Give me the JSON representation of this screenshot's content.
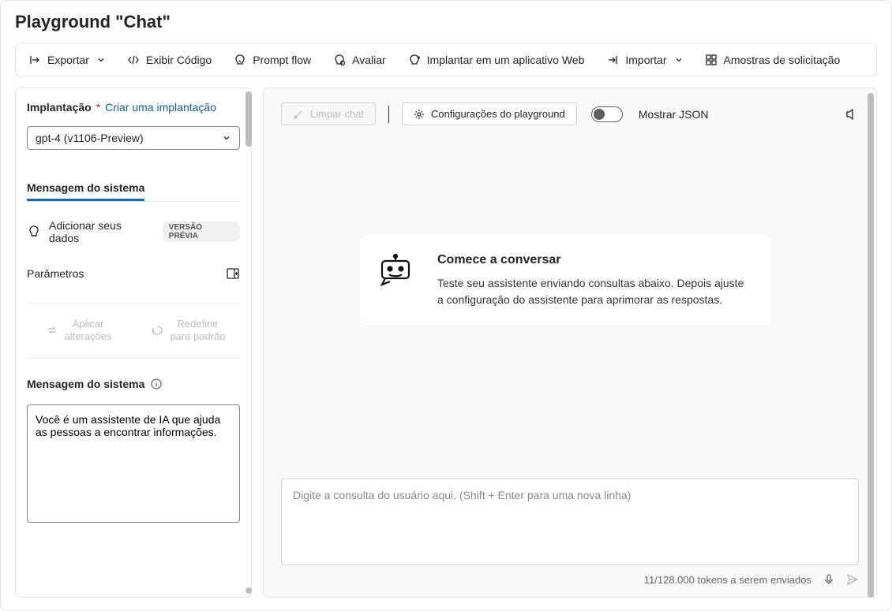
{
  "page_title": "Playground \"Chat\"",
  "toolbar": {
    "export": "Exportar",
    "view_code": "Exibir Código",
    "prompt_flow": "Prompt flow",
    "evaluate": "Avaliar",
    "deploy_web": "Implantar em um aplicativo Web",
    "import": "Importar",
    "samples": "Amostras de solicitação"
  },
  "sidebar": {
    "deployment_label": "Implantação",
    "create_link": "Criar uma implantação",
    "deployment_value": "gpt-4 (v1106-Preview)",
    "system_tab": "Mensagem do sistema",
    "add_data": "Adicionar seus dados",
    "preview_badge": "VERSÃO PRÉVIA",
    "parameters": "Parâmetros",
    "apply1": "Aplicar",
    "apply2": "alterações",
    "reset1": "Redefinir",
    "reset2": "para padrão",
    "sys_heading": "Mensagem do sistema",
    "sys_msg": "Você é um assistente de IA que ajuda as pessoas a encontrar informações."
  },
  "chat": {
    "clear": "Limpar chat",
    "playground_settings": "Configurações do playground",
    "show_json": "Mostrar JSON",
    "card_title": "Comece a conversar",
    "card_body": "Teste seu assistente enviando consultas abaixo. Depois ajuste a configuração do assistente para aprimorar as respostas.",
    "placeholder": "Digite a consulta do usuário aqui. (Shift + Enter para uma nova linha)",
    "token_status": "11/128.000 tokens a serem enviados"
  }
}
